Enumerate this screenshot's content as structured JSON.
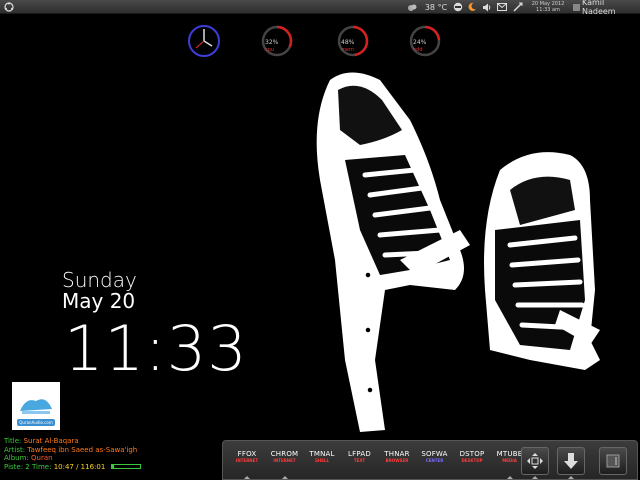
{
  "topbar": {
    "temperature": "38 °C",
    "date": "20 May 2012",
    "time": "11:33 am",
    "user": "Kamil Nadeem",
    "icons": [
      "ubuntu-logo-icon",
      "weather-icon",
      "sync-icon",
      "moon-icon",
      "volume-icon",
      "mail-icon",
      "network-icon",
      "power-icon"
    ]
  },
  "rings": [
    {
      "value": "32%",
      "label": "cpu",
      "percent": 32
    },
    {
      "value": "48%",
      "label": "mem",
      "percent": 48
    },
    {
      "value": "24%",
      "label": "hdd",
      "percent": 24
    }
  ],
  "clock_widget": {
    "day": "Sunday",
    "date": "May 20",
    "time": "11:33"
  },
  "album_art": {
    "tag": "QuranAudio.com"
  },
  "track": {
    "title_key": "Title:",
    "title": "Surat Al-Baqara",
    "artist_key": "Artist:",
    "artist": "Tawfeeq ibn Saeed as-Sawa'igh",
    "album_key": "Album:",
    "album": "Quran",
    "piste_key": "Piste: 2 Time:",
    "time": "10:47 / 116:01",
    "progress": 0.09
  },
  "dock": {
    "launchers": [
      {
        "name": "FFOX",
        "category": "INTERNET",
        "color": "#ff3b3b",
        "running": true
      },
      {
        "name": "CHROM",
        "category": "INTERNET",
        "color": "#ff3b3b",
        "running": true
      },
      {
        "name": "TMNAL",
        "category": "SHELL",
        "color": "#ff3b3b",
        "running": false
      },
      {
        "name": "LFPAD",
        "category": "TEXT",
        "color": "#ff3b3b",
        "running": false
      },
      {
        "name": "THNAR",
        "category": "BROWSER",
        "color": "#ff3b3b",
        "running": false
      },
      {
        "name": "SOFWA",
        "category": "CENTER",
        "color": "#7a6bff",
        "running": false
      },
      {
        "name": "DSTOP",
        "category": "DESKTOP",
        "color": "#ff3b3b",
        "running": false
      },
      {
        "name": "MTUBE",
        "category": "MEDIA",
        "color": "#ff3b3b",
        "running": true
      }
    ],
    "buttons": [
      "move-icon",
      "download-icon",
      "show-desktop-icon"
    ]
  }
}
